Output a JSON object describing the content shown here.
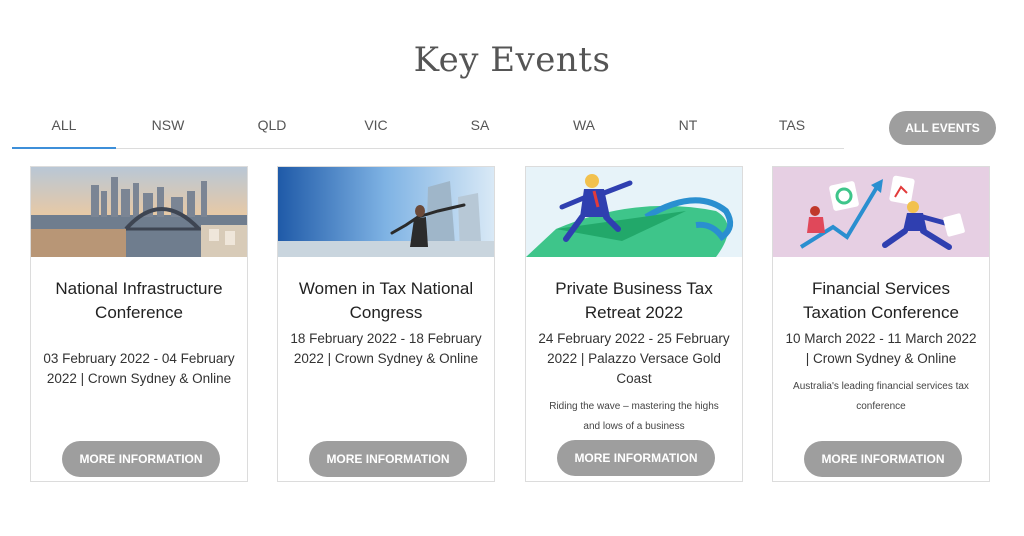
{
  "page_title": "Key Events",
  "tabs": [
    "ALL",
    "NSW",
    "QLD",
    "VIC",
    "SA",
    "WA",
    "NT",
    "TAS"
  ],
  "all_events_label": "ALL EVENTS",
  "events": [
    {
      "title": "National Infrastructure Conference",
      "date": "03 February 2022 - 04 February 2022 | Crown Sydney & Online",
      "description": "",
      "button": "MORE INFORMATION",
      "image": "sydney-harbour-bridge-skyline"
    },
    {
      "title": "Women in Tax National Congress",
      "date": "18 February 2022 - 18 February 2022 | Crown Sydney & Online",
      "description": "",
      "button": "MORE INFORMATION",
      "image": "woman-arms-outstretched-city"
    },
    {
      "title": "Private Business Tax Retreat 2022",
      "date": "24 February 2022 - 25 February 2022 | Palazzo Versace Gold Coast",
      "description": "Riding the wave – mastering the highs and lows of a business",
      "button": "MORE INFORMATION",
      "image": "businessman-surfing-wave-illustration"
    },
    {
      "title": "Financial Services Taxation Conference",
      "date": "10 March 2022 - 11 March 2022 | Crown Sydney & Online",
      "description": "Australia's leading financial services tax conference",
      "button": "MORE INFORMATION",
      "image": "business-growth-chart-illustration"
    }
  ]
}
